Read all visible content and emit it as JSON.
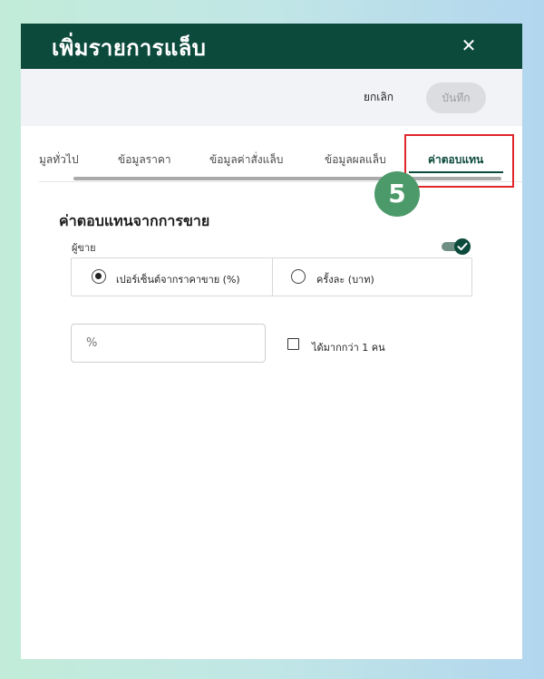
{
  "dialog": {
    "title": "เพิ่มรายการแล็บ",
    "close_icon": "close-icon"
  },
  "actions": {
    "cancel_label": "ยกเลิก",
    "save_label": "บันทึก"
  },
  "tabs": [
    {
      "label": "มูลทั่วไป",
      "active": false
    },
    {
      "label": "ข้อมูลราคา",
      "active": false
    },
    {
      "label": "ข้อมูลค่าสั่งแล็บ",
      "active": false
    },
    {
      "label": "ข้อมูลผลแล็บ",
      "active": false
    },
    {
      "label": "ค่าตอบแทน",
      "active": true
    }
  ],
  "annotation": {
    "step_number": "5",
    "highlight_color": "#e0262a",
    "badge_color": "#4c9a6a"
  },
  "section": {
    "title": "ค่าตอบแทนจากการขาย",
    "seller_label": "ผู้ขาย",
    "seller_toggle_on": true
  },
  "radio_options": [
    {
      "label": "เปอร์เซ็นต์จากราคาขาย (%)",
      "selected": true
    },
    {
      "label": "ครั้งละ (บาท)",
      "selected": false
    }
  ],
  "percent_input": {
    "placeholder": "%",
    "value": ""
  },
  "multi_person": {
    "label": "ได้มากกว่า 1 คน",
    "checked": false
  },
  "colors": {
    "primary": "#0c4a3c",
    "save_disabled_bg": "#dcdde0"
  }
}
